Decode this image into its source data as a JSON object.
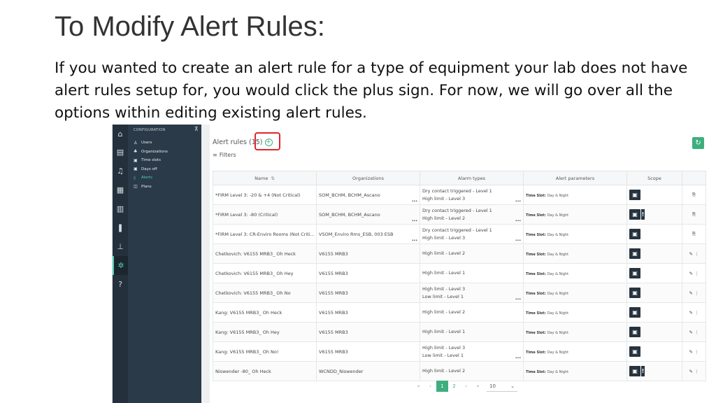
{
  "slide": {
    "title": "To Modify Alert Rules:",
    "body": "If you wanted to create an alert rule for a type of equipment your lab does not have alert rules setup for, you would click the plus sign. For now, we will go over all the options within editing existing alert rules."
  },
  "rail": {
    "icons": [
      "home-icon",
      "clipboard-icon",
      "bell-icon",
      "document-icon",
      "device-icon",
      "thermometer-icon",
      "microscope-icon",
      "gear-icon",
      "help-icon"
    ],
    "glyphs": [
      "⌂",
      "▤",
      "♫",
      "▦",
      "▥",
      "❚",
      "⊥",
      "✲",
      "?"
    ],
    "active_index": 7
  },
  "config": {
    "heading": "CONFIGURATION",
    "pin_glyph": "⊼",
    "items": [
      {
        "label": "Users",
        "icon": "user-icon",
        "glyph": "♙"
      },
      {
        "label": "Organizations",
        "icon": "org-icon",
        "glyph": "♣"
      },
      {
        "label": "Time slots",
        "icon": "clock-icon",
        "glyph": "▣"
      },
      {
        "label": "Days off",
        "icon": "calendar-icon",
        "glyph": "▣"
      },
      {
        "label": "Alerts",
        "icon": "bell-icon",
        "glyph": "◊",
        "active": true
      },
      {
        "label": "Plans",
        "icon": "book-icon",
        "glyph": "◫"
      }
    ]
  },
  "panel": {
    "title": "Alert rules (15)",
    "add_glyph": "+",
    "filters_label": "Filters",
    "filters_glyph": "≡",
    "refresh_glyph": "↻",
    "columns": [
      "Name",
      "Organizations",
      "Alarm types",
      "Alert parameters",
      "Scope",
      ""
    ],
    "name_sort_glyph": "⇅",
    "timeslot_label": "Time Slot:",
    "timeslot_value": "Day & Night",
    "scope_glyph": "▣",
    "scope_excl": "!",
    "ellipsis": "...",
    "copy_glyph": "⎘",
    "edit_glyph": "✎ ⋮",
    "rows": [
      {
        "name": "*FIRM Level 3: -20 & +4 (Not Critical)",
        "org": "SOM_BCHM, BCHM_Ascano",
        "org_more": true,
        "alarms": [
          "Dry contact triggered - Level 1",
          "High limit - Level 3"
        ],
        "alarm_more": true,
        "excl": false,
        "action": "copy"
      },
      {
        "name": "*FIRM Level 3: -80 (Critical)",
        "org": "SOM_BCHM, BCHM_Ascano",
        "org_more": true,
        "alarms": [
          "Dry contact triggered - Level 1",
          "High limit - Level 2"
        ],
        "alarm_more": true,
        "excl": true,
        "action": "copy"
      },
      {
        "name": "*FIRM Level 3: CR-Enviro Rooms (Not Criti...",
        "org": "VSOM_Enviro Rms_ESB, 003 ESB",
        "org_more": true,
        "alarms": [
          "Dry contact triggered - Level 1",
          "High limit - Level 3"
        ],
        "alarm_more": true,
        "excl": false,
        "action": "copy"
      },
      {
        "name": "Chetkovich: V6155 MRB3_ Oh Heck",
        "org": "V6155 MRB3",
        "org_more": false,
        "alarms": [
          "High limit - Level 2"
        ],
        "alarm_more": false,
        "excl": false,
        "action": "edit"
      },
      {
        "name": "Chetkovich: V6155 MRB3_ Oh Hey",
        "org": "V6155 MRB3",
        "org_more": false,
        "alarms": [
          "High limit - Level 1"
        ],
        "alarm_more": false,
        "excl": false,
        "action": "edit"
      },
      {
        "name": "Chetkovich: V6155 MRB3_ Oh No",
        "org": "V6155 MRB3",
        "org_more": false,
        "alarms": [
          "High limit - Level 3",
          "Low limit - Level 1"
        ],
        "alarm_more": true,
        "excl": false,
        "action": "edit"
      },
      {
        "name": "Kang: V6155 MRB3_ Oh Heck",
        "org": "V6155 MRB3",
        "org_more": false,
        "alarms": [
          "High limit - Level 2"
        ],
        "alarm_more": false,
        "excl": false,
        "action": "edit"
      },
      {
        "name": "Kang: V6155 MRB3_ Oh Hey",
        "org": "V6155 MRB3",
        "org_more": false,
        "alarms": [
          "High limit - Level 1"
        ],
        "alarm_more": false,
        "excl": false,
        "action": "edit"
      },
      {
        "name": "Kang: V6155 MRB3_ Oh No!",
        "org": "V6155 MRB3",
        "org_more": false,
        "alarms": [
          "High limit - Level 3",
          "Low limit - Level 1"
        ],
        "alarm_more": true,
        "excl": false,
        "action": "edit"
      },
      {
        "name": "Niswender -80_ Oh Heck",
        "org": "WCNDD_Niswender",
        "org_more": false,
        "alarms": [
          "High limit - Level 2"
        ],
        "alarm_more": false,
        "excl": true,
        "action": "edit"
      }
    ]
  },
  "pager": {
    "first": "«",
    "prev": "‹",
    "next": "›",
    "last": "»",
    "pages": [
      "1",
      "2"
    ],
    "active_page": "1",
    "page_size": "10",
    "dropdown_glyph": "⌄"
  }
}
